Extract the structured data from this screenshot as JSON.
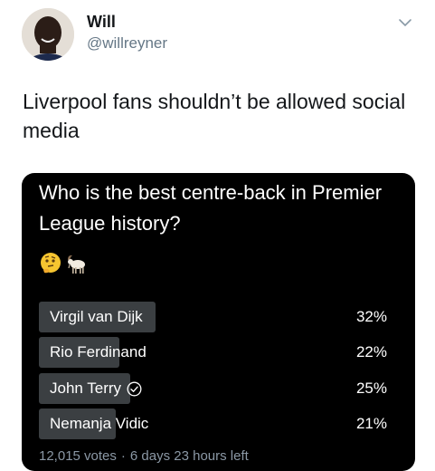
{
  "tweet": {
    "author_name": "Will",
    "author_handle": "@willreyner",
    "text": "Liverpool fans shouldn’t be allowed social media"
  },
  "poll": {
    "question": "Who is the best centre-back in Premier League history?",
    "emojis": [
      "thinking-face",
      "goat"
    ],
    "options": [
      {
        "label": "Virgil van Dijk",
        "percent": 32,
        "percent_label": "32%",
        "selected": false
      },
      {
        "label": "Rio Ferdinand",
        "percent": 22,
        "percent_label": "22%",
        "selected": false
      },
      {
        "label": "John Terry",
        "percent": 25,
        "percent_label": "25%",
        "selected": true
      },
      {
        "label": "Nemanja Vidic",
        "percent": 21,
        "percent_label": "21%",
        "selected": false
      }
    ],
    "votes": "12,015 votes",
    "time_left": "6 days 23 hours left"
  },
  "colors": {
    "card_bg": "#000000",
    "bar": "#3b3f42",
    "meta": "#8b98a5",
    "handle": "#657786"
  }
}
